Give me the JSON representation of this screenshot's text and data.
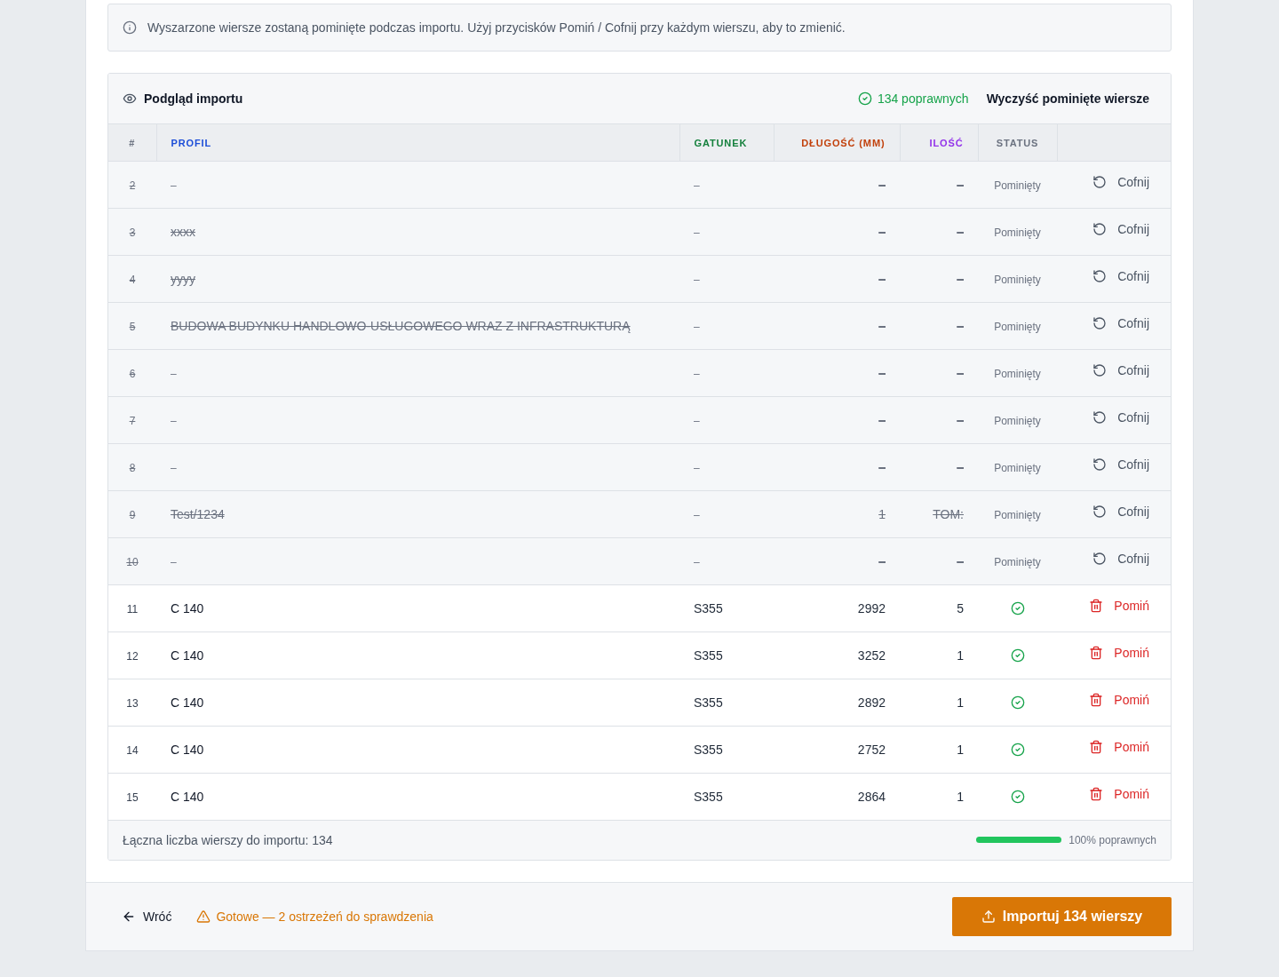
{
  "notice": {
    "text": "Wyszarzone wiersze zostaną pominięte podczas importu. Użyj przycisków Pomiń / Cofnij przy każdym wierszu, aby to zmienić."
  },
  "preview": {
    "title": "Podgląd importu",
    "valid_count": "134 poprawnych",
    "clear_button": "Wyczyść pominięte wiersze",
    "columns": [
      {
        "label": "#",
        "color": "#6b7280"
      },
      {
        "label": "PROFIL",
        "color": "#1d4ed8"
      },
      {
        "label": "GATUNEK",
        "color": "#15803d"
      },
      {
        "label": "DŁUGOŚĆ (MM)",
        "color": "#c2410c"
      },
      {
        "label": "ILOŚĆ",
        "color": "#9333ea"
      },
      {
        "label": "STATUS",
        "color": "#6b7280"
      }
    ],
    "rows": [
      {
        "number": "2",
        "profil": "–",
        "profil_empty": true,
        "gatunek": "–",
        "dlugosc_mm": "–",
        "ilosc": "–",
        "skipped": true,
        "status": "Pominięty",
        "action": "Cofnij"
      },
      {
        "number": "3",
        "profil": "xxxx",
        "profil_empty": false,
        "gatunek": "–",
        "dlugosc_mm": "–",
        "ilosc": "–",
        "skipped": true,
        "status": "Pominięty",
        "action": "Cofnij"
      },
      {
        "number": "4",
        "profil": "yyyy",
        "profil_empty": false,
        "gatunek": "–",
        "dlugosc_mm": "–",
        "ilosc": "–",
        "skipped": true,
        "status": "Pominięty",
        "action": "Cofnij"
      },
      {
        "number": "5",
        "profil": "BUDOWA BUDYNKU HANDLOWO-USŁUGOWEGO WRAZ Z INFRASTRUKTURĄ",
        "profil_empty": false,
        "gatunek": "–",
        "dlugosc_mm": "–",
        "ilosc": "–",
        "skipped": true,
        "status": "Pominięty",
        "action": "Cofnij"
      },
      {
        "number": "6",
        "profil": "–",
        "profil_empty": true,
        "gatunek": "–",
        "dlugosc_mm": "–",
        "ilosc": "–",
        "skipped": true,
        "status": "Pominięty",
        "action": "Cofnij"
      },
      {
        "number": "7",
        "profil": "–",
        "profil_empty": true,
        "gatunek": "–",
        "dlugosc_mm": "–",
        "ilosc": "–",
        "skipped": true,
        "status": "Pominięty",
        "action": "Cofnij"
      },
      {
        "number": "8",
        "profil": "–",
        "profil_empty": true,
        "gatunek": "–",
        "dlugosc_mm": "–",
        "ilosc": "–",
        "skipped": true,
        "status": "Pominięty",
        "action": "Cofnij"
      },
      {
        "number": "9",
        "profil": "Test/1234",
        "profil_empty": false,
        "gatunek": "–",
        "dlugosc_mm": "1",
        "ilosc": "TOM:",
        "skipped": true,
        "status": "Pominięty",
        "action": "Cofnij"
      },
      {
        "number": "10",
        "profil": "–",
        "profil_empty": true,
        "gatunek": "–",
        "dlugosc_mm": "–",
        "ilosc": "–",
        "skipped": true,
        "status": "Pominięty",
        "action": "Cofnij"
      },
      {
        "number": "11",
        "profil": "C 140",
        "profil_empty": false,
        "gatunek": "S355",
        "dlugosc_mm": "2992",
        "ilosc": "5",
        "skipped": false,
        "action": "Pomiń"
      },
      {
        "number": "12",
        "profil": "C 140",
        "profil_empty": false,
        "gatunek": "S355",
        "dlugosc_mm": "3252",
        "ilosc": "1",
        "skipped": false,
        "action": "Pomiń"
      },
      {
        "number": "13",
        "profil": "C 140",
        "profil_empty": false,
        "gatunek": "S355",
        "dlugosc_mm": "2892",
        "ilosc": "1",
        "skipped": false,
        "action": "Pomiń"
      },
      {
        "number": "14",
        "profil": "C 140",
        "profil_empty": false,
        "gatunek": "S355",
        "dlugosc_mm": "2752",
        "ilosc": "1",
        "skipped": false,
        "action": "Pomiń"
      },
      {
        "number": "15",
        "profil": "C 140",
        "profil_empty": false,
        "gatunek": "S355",
        "dlugosc_mm": "2864",
        "ilosc": "1",
        "skipped": false,
        "action": "Pomiń"
      }
    ],
    "summary": {
      "total": "Łączna liczba wierszy do importu: 134",
      "level": 1,
      "reading": "100% poprawnych"
    }
  },
  "footer": {
    "back_button": "Wróć",
    "warning": "Gotowe — 2 ostrzeżeń do sprawdzenia",
    "import_button": "Importuj 134 wierszy"
  }
}
